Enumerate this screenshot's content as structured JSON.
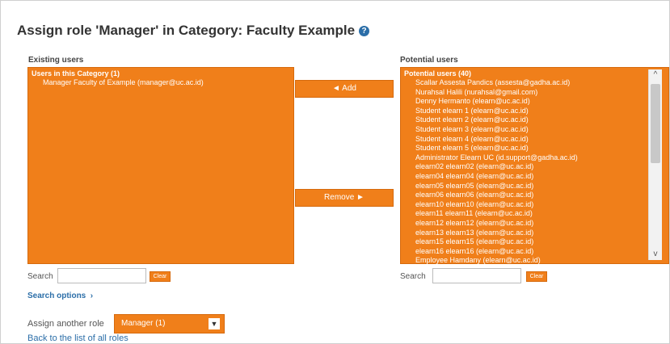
{
  "page": {
    "title": "Assign role 'Manager' in Category: Faculty Example"
  },
  "existing": {
    "label": "Existing users",
    "group": "Users in this Category (1)",
    "items": [
      "Manager Faculty of Example (manager@uc.ac.id)"
    ]
  },
  "buttons": {
    "add": "◄ Add",
    "remove": "Remove ►"
  },
  "potential": {
    "label": "Potential users",
    "group": "Potential users (40)",
    "items": [
      "Scallar Assesta Pandics (assesta@gadha.ac.id)",
      "Nurahsal Halili (nurahsal@gmail.com)",
      "Denny Hermanto (elearn@uc.ac.id)",
      "Student elearn 1 (elearn@uc.ac.id)",
      "Student elearn 2 (elearn@uc.ac.id)",
      "Student elearn 3 (elearn@uc.ac.id)",
      "Student elearn 4 (elearn@uc.ac.id)",
      "Student elearn 5 (elearn@uc.ac.id)",
      "Administrator Elearn UC (id.support@gadha.ac.id)",
      "elearn02 elearn02 (elearn@uc.ac.id)",
      "elearn04 elearn04 (elearn@uc.ac.id)",
      "elearn05 elearn05 (elearn@uc.ac.id)",
      "elearn06 elearn06 (elearn@uc.ac.id)",
      "elearn10 elearn10 (elearn@uc.ac.id)",
      "elearn11 elearn11 (elearn@uc.ac.id)",
      "elearn12 elearn12 (elearn@uc.ac.id)",
      "elearn13 elearn13 (elearn@uc.ac.id)",
      "elearn15 elearn15 (elearn@uc.ac.id)",
      "elearn16 elearn16 (elearn@uc.ac.id)",
      "Employee Hamdany (elearn@uc.ac.id)"
    ]
  },
  "search": {
    "label": "Search",
    "value": "",
    "clear": "Clear"
  },
  "search_options": "Search options",
  "assign_another": {
    "label": "Assign another role",
    "selected": "Manager (1)"
  },
  "back_link": "Back to the list of all roles",
  "colors": {
    "accent": "#f07f1a",
    "link": "#2b6ea8"
  }
}
